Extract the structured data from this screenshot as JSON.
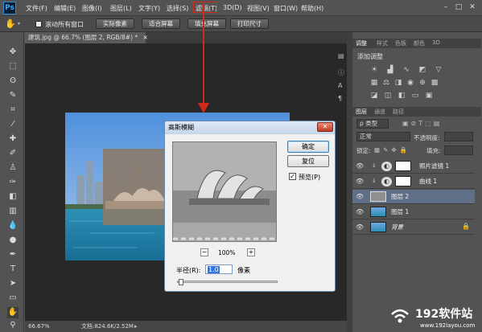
{
  "app": {
    "logo": "Ps"
  },
  "menu": [
    "文件(F)",
    "编辑(E)",
    "图像(I)",
    "图层(L)",
    "文字(Y)",
    "选择(S)",
    "滤镜(T)",
    "3D(D)",
    "视图(V)",
    "窗口(W)",
    "帮助(H)"
  ],
  "window_controls": [
    "–",
    "□",
    "✕"
  ],
  "options": {
    "scroll_all_label": "滚动所有窗口",
    "buttons": [
      "实际像素",
      "适合屏幕",
      "填充屏幕",
      "打印尺寸"
    ]
  },
  "document": {
    "tab_title": "建筑.jpg @ 66.7% (图层 2, RGB/8#) *",
    "close_glyph": "×"
  },
  "status": {
    "zoom": "66.67%",
    "doc_info": "文档:824.6K/2.52M"
  },
  "panels": {
    "top_tabs": [
      "调整",
      "样式",
      "色板",
      "颜色",
      "3D"
    ],
    "adjust_title": "添加调整",
    "layer_tabs": [
      "图层",
      "通道",
      "路径"
    ],
    "kind_label": "ρ 类型",
    "blend_mode": "正常",
    "opacity_label": "不透明度:",
    "lock_label": "锁定:",
    "fill_label": "填充:",
    "layers": [
      {
        "name": "照片滤镜 1",
        "type": "adjustment"
      },
      {
        "name": "曲线 1",
        "type": "adjustment"
      },
      {
        "name": "图层 2",
        "type": "pixel",
        "selected": true
      },
      {
        "name": "图层 1",
        "type": "pixel"
      },
      {
        "name": "背景",
        "type": "background"
      }
    ]
  },
  "dialog": {
    "title": "高斯模糊",
    "ok": "确定",
    "reset": "复位",
    "preview_label": "预览(P)",
    "zoom": "100%",
    "zoom_minus": "−",
    "zoom_plus": "+",
    "radius_label": "半径(R):",
    "radius_value": "1.0",
    "unit": "像素"
  },
  "watermark": {
    "name": "192软件站",
    "url": "www.192layou.com"
  },
  "colors": {
    "accent": "#d12a1a",
    "ps_blue": "#30a7ff",
    "selected_layer": "#5f6f87"
  }
}
